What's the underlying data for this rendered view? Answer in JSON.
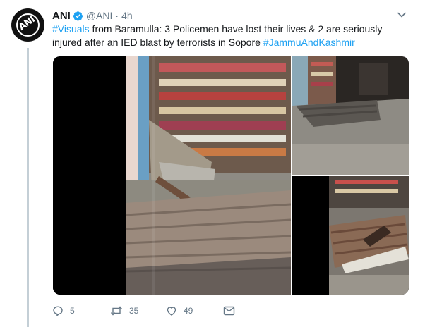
{
  "tweet": {
    "author_name": "ANI",
    "author_handle": "@ANI",
    "separator": "·",
    "time": "4h",
    "text_parts": {
      "hashtag_1": "#Visuals",
      "body_1": " from Baramulla: 3 Policemen have lost their lives & 2 are seriously injured after an IED blast by terrorists in Sopore ",
      "hashtag_2": "#JammuAndKashmir"
    }
  },
  "avatar": {
    "logo_text": "ANI"
  },
  "icons": {
    "verified": "verified-badge-icon",
    "menu": "chevron-down-icon",
    "reply": "reply-icon",
    "retweet": "retweet-icon",
    "like": "heart-icon",
    "dm": "envelope-icon"
  },
  "actions": {
    "replies": "5",
    "retweets": "35",
    "likes": "49"
  },
  "colors": {
    "accent": "#1da1f2",
    "muted": "#657786",
    "text": "#14171a",
    "thread_line": "#c4cfd6"
  }
}
